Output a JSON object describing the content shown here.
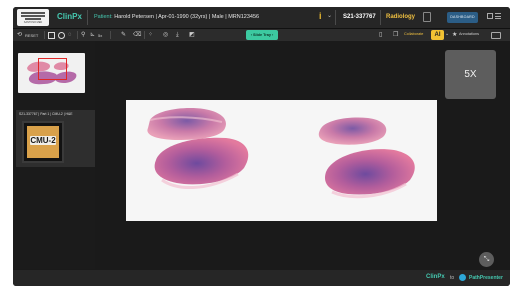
{
  "header": {
    "logo_caption": "SANTOSO MED",
    "app_name": "ClinPx",
    "patient_label": "Patient:",
    "patient_info": "Harold Petersen | Apr-01-1990 (32yrs) | Male | MRN123456",
    "info_icon": "i",
    "case_id": "S21-337767",
    "department": "Radiology",
    "dashboard_label": "DASHBOARD"
  },
  "toolbar": {
    "reset_label": "RESET",
    "zoom_label": "5x",
    "slide_tray_label": "Slide Tray",
    "collaborate_label": "Collaborate",
    "ai_label": "AI",
    "annotations_label": "Annotations"
  },
  "left_panel": {
    "case_card_label": "S21-337767 | Part 1 | CMU-2 | H&E",
    "slide_label_text": "CMU-2"
  },
  "viewer": {
    "magnification": "5X"
  },
  "footer": {
    "app_name": "ClinPx",
    "to_label": "to",
    "partner_name": "PathPresenter"
  },
  "colors": {
    "accent_teal": "#45c8b0",
    "dept_gold": "#f0c040",
    "ai_yellow": "#f2c233",
    "slide_tray_green": "#3cc9a0",
    "dashboard_blue": "#2b5d86",
    "stain_pink": "#e07a9a",
    "stain_purple": "#8a5aa8"
  },
  "icons": [
    "reset-icon",
    "rect-tool-icon",
    "circle-tool-icon",
    "lasso-icon",
    "link-icon",
    "ruler-icon",
    "pen-icon",
    "eraser-icon",
    "dots-icon",
    "camera-icon",
    "download-icon",
    "contrast-icon",
    "bookmark-icon",
    "copy-icon",
    "star-icon",
    "keyboard-icon",
    "grid-icon",
    "menu-icon",
    "zoom-fit-icon"
  ]
}
